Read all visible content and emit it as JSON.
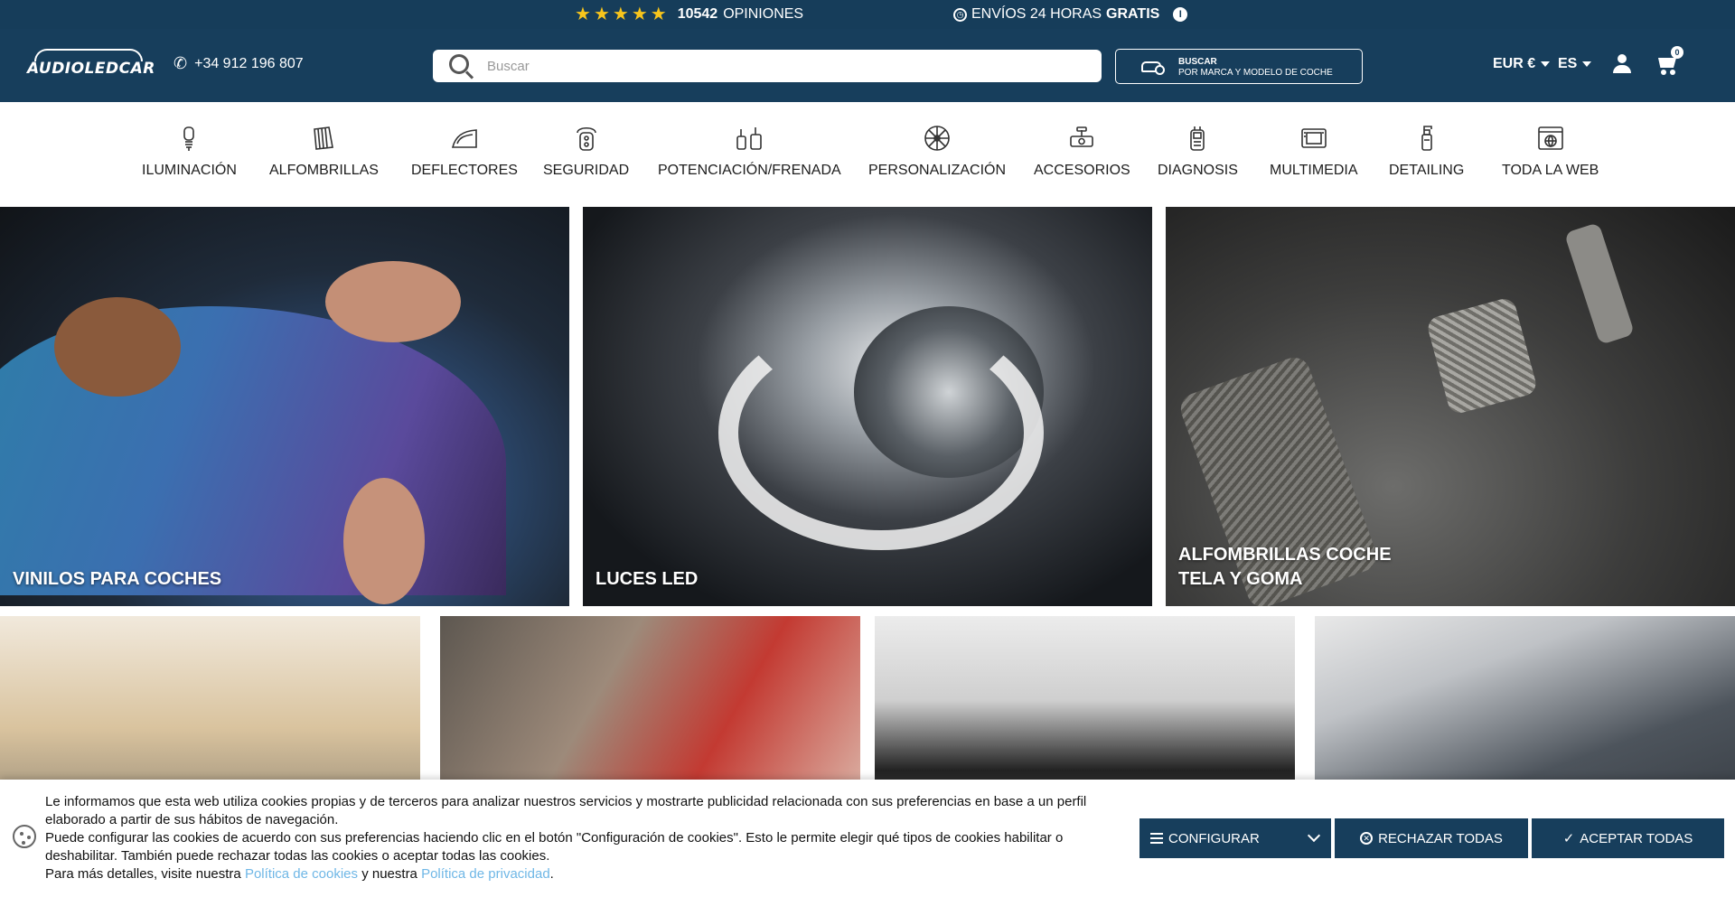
{
  "topbar": {
    "rating_count": "10542",
    "rating_label": "OPINIONES",
    "stars": 5,
    "shipping_text": "ENVÍOS 24 HORAS",
    "shipping_bold": "GRATIS"
  },
  "header": {
    "logo_text": "AUDIOLEDCAR",
    "phone": "+34 912 196 807",
    "search_placeholder": "Buscar",
    "car_search_title": "BUSCAR",
    "car_search_subtitle": "POR MARCA Y MODELO DE COCHE",
    "currency": "EUR €",
    "language": "ES",
    "cart_count": "0"
  },
  "categories": [
    {
      "label": "ILUMINACIÓN",
      "icon": "bulb-icon"
    },
    {
      "label": "ALFOMBRILLAS",
      "icon": "floor-mat-icon"
    },
    {
      "label": "DEFLECTORES",
      "icon": "wind-deflector-icon"
    },
    {
      "label": "SEGURIDAD",
      "icon": "alarm-remote-icon"
    },
    {
      "label": "POTENCIACIÓN/FRENADA",
      "icon": "tuning-box-icon"
    },
    {
      "label": "PERSONALIZACIÓN",
      "icon": "wheel-icon"
    },
    {
      "label": "ACCESORIOS",
      "icon": "dashcam-icon"
    },
    {
      "label": "DIAGNOSIS",
      "icon": "obd-scanner-icon"
    },
    {
      "label": "MULTIMEDIA",
      "icon": "screen-icon"
    },
    {
      "label": "DETAILING",
      "icon": "spray-bottle-icon"
    },
    {
      "label": "TODA LA WEB",
      "icon": "globe-window-icon"
    }
  ],
  "tiles": [
    {
      "label": "VINILOS PARA COCHES"
    },
    {
      "label": "LUCES LED"
    },
    {
      "label_line1": "ALFOMBRILLAS COCHE",
      "label_line2": "TELA Y GOMA"
    }
  ],
  "cookie": {
    "line1": "Le informamos que esta web utiliza cookies propias y de terceros para analizar nuestros servicios y mostrarte publicidad relacionada con sus preferencias en base a un perfil elaborado a partir de sus hábitos de navegación.",
    "line2": "Puede configurar las cookies de acuerdo con sus preferencias haciendo clic en el botón \"Configuración de cookies\". Esto le permite elegir qué tipos de cookies habilitar o deshabilitar. También puede rechazar todas las cookies o aceptar todas las cookies.",
    "line3_prefix": "Para más detalles, visite nuestra",
    "cookies_policy_link": "Política de cookies",
    "line3_middle": "y nuestra",
    "privacy_policy_link": "Política de privacidad",
    "line3_suffix": ".",
    "configure_label": "CONFIGURAR",
    "reject_label": "RECHAZAR TODAS",
    "accept_label": "ACEPTAR TODAS"
  },
  "colors": {
    "brand_dark": "#173e5c",
    "star": "#f7c51c",
    "link": "#6fb7e6"
  }
}
